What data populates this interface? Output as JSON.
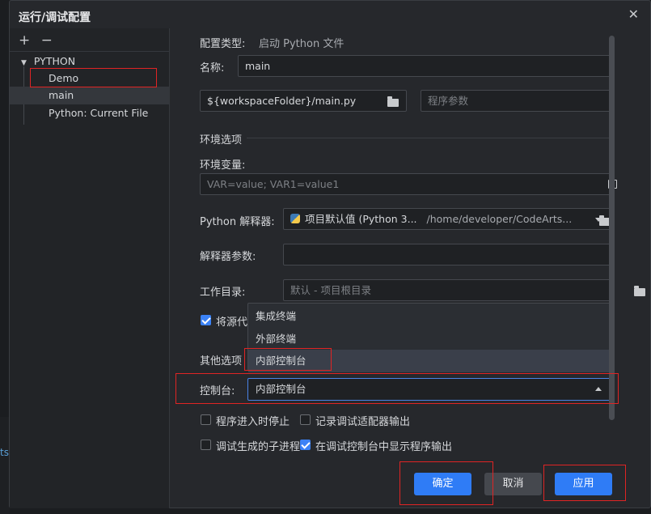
{
  "window": {
    "title": "运行/调试配置",
    "close_glyph": "✕"
  },
  "sidebar": {
    "add_glyph": "+",
    "remove_glyph": "−",
    "group_label": "PYTHON",
    "items": [
      {
        "label": "Demo"
      },
      {
        "label": "main"
      },
      {
        "label": "Python: Current File"
      }
    ]
  },
  "form": {
    "config_type_label": "配置类型:",
    "config_type_value": "启动 Python 文件",
    "name_label": "名称:",
    "name_value": "main",
    "program_path": "${workspaceFolder}/main.py",
    "program_args_placeholder": "程序参数",
    "env_section_title": "环境选项",
    "env_vars_label": "环境变量:",
    "env_vars_placeholder": "VAR=value; VAR1=value1",
    "interpreter_label": "Python 解释器:",
    "interpreter_name": "项目默认值 (Python 3...",
    "interpreter_path": "/home/developer/CodeArts...",
    "interpreter_args_label": "解释器参数:",
    "workdir_label": "工作目录:",
    "workdir_placeholder": "默认 - 项目根目录",
    "source_checkbox_label": "将源代",
    "other_section_label": "其他选项",
    "console_label": "控制台:",
    "console_value": "内部控制台",
    "console_options": [
      "集成终端",
      "外部终端",
      "内部控制台"
    ],
    "checkboxes": [
      {
        "label": "程序进入时停止",
        "checked": false
      },
      {
        "label": "记录调试适配器输出",
        "checked": false
      },
      {
        "label": "调试生成的子进程",
        "checked": false
      },
      {
        "label": "在调试控制台中显示程序输出",
        "checked": true
      }
    ]
  },
  "buttons": {
    "ok": "确定",
    "cancel": "取消",
    "apply": "应用"
  },
  "background": {
    "edge_text": "ts"
  },
  "colors": {
    "accent": "#2f7cf6",
    "highlight": "#e02424",
    "dialog_bg": "#26282c"
  }
}
